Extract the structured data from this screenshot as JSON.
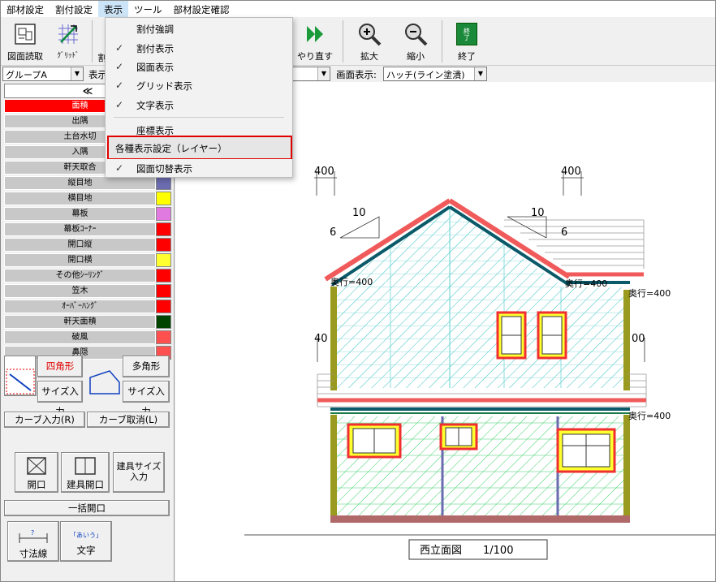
{
  "menubar": {
    "items": [
      "部材設定",
      "割付設定",
      "表示",
      "ツール",
      "部材設定確認"
    ]
  },
  "toolbar": {
    "read_drawing": "図面読取",
    "grid": "ｸﾞﾘｯﾄﾞ",
    "partial1": "割",
    "redo": "やり直す",
    "zoom_in": "拡大",
    "zoom_out": "縮小",
    "exit": "終了",
    "exit_icon_text": "終了"
  },
  "row2": {
    "group_value": "グループA",
    "display_label": "表示",
    "screen_display_label": "画面表示:",
    "screen_display_value": "ハッチ(ライン塗潰)"
  },
  "left": {
    "nav": "≪",
    "layers": [
      {
        "name": "面積",
        "color": "#ff0000",
        "label_bg": "#ff0000",
        "label_color": "#ffffff"
      },
      {
        "name": "出隅",
        "color": "#ff0000"
      },
      {
        "name": "土台水切",
        "color": "#ff0000"
      },
      {
        "name": "入隅",
        "color": "#ff0000"
      },
      {
        "name": "軒天取合",
        "color": "#ff0000"
      },
      {
        "name": "縦目地",
        "color": "#6b6bb0"
      },
      {
        "name": "横目地",
        "color": "#ffff00"
      },
      {
        "name": "幕板",
        "color": "#e07ae0"
      },
      {
        "name": "幕板ｺｰﾅｰ",
        "color": "#ff0000"
      },
      {
        "name": "開口縦",
        "color": "#ff0000"
      },
      {
        "name": "開口横",
        "color": "#ffff30"
      },
      {
        "name": "その他ｼｰﾘﾝｸﾞ",
        "color": "#ff0000"
      },
      {
        "name": "笠木",
        "color": "#ff0000"
      },
      {
        "name": "ｵｰﾊﾞｰﾊﾝｸﾞ",
        "color": "#ff0000"
      },
      {
        "name": "軒天面積",
        "color": "#004400"
      },
      {
        "name": "破風",
        "color": "#ff5050"
      },
      {
        "name": "鼻隠",
        "color": "#ff5050"
      }
    ],
    "rect_btn": "四角形",
    "poly_btn": "多角形",
    "size_input1": "サイズ入力",
    "size_input2": "サイズ入力",
    "curve_input": "カーブ入力(R)",
    "curve_cancel": "カーブ取消(L)",
    "opening": "開口",
    "fitting_opening": "建具開口",
    "fitting_size_input": "建具サイズ入力",
    "bulk_opening": "一括開口",
    "dim_line": "寸法線",
    "text": "文字",
    "text_icon": "｢あいう｣",
    "dim_icon": "?"
  },
  "dropdown": {
    "items": [
      {
        "label": "割付強調",
        "checked": false
      },
      {
        "label": "割付表示",
        "checked": true
      },
      {
        "label": "図面表示",
        "checked": true
      },
      {
        "label": "グリッド表示",
        "checked": true
      },
      {
        "label": "文字表示",
        "checked": true
      },
      {
        "label": "座標表示",
        "checked": false
      },
      {
        "label": "各種表示設定（レイヤー）",
        "checked": false
      },
      {
        "label": "図面切替表示",
        "checked": true
      }
    ],
    "check_mark": "✓"
  },
  "drawing": {
    "title": "西立面図　　1/100",
    "dim_400_a": "400",
    "dim_400_b": "400",
    "dim_400_c": "40",
    "dim_400_d": "00",
    "slope_run": "10",
    "slope_rise": "6",
    "slope_run2": "10",
    "slope_rise2": "6",
    "depth1": "奥行=400",
    "depth2": "奥行=400",
    "depth3": "奥行=400",
    "depth4": "奥行=400"
  }
}
